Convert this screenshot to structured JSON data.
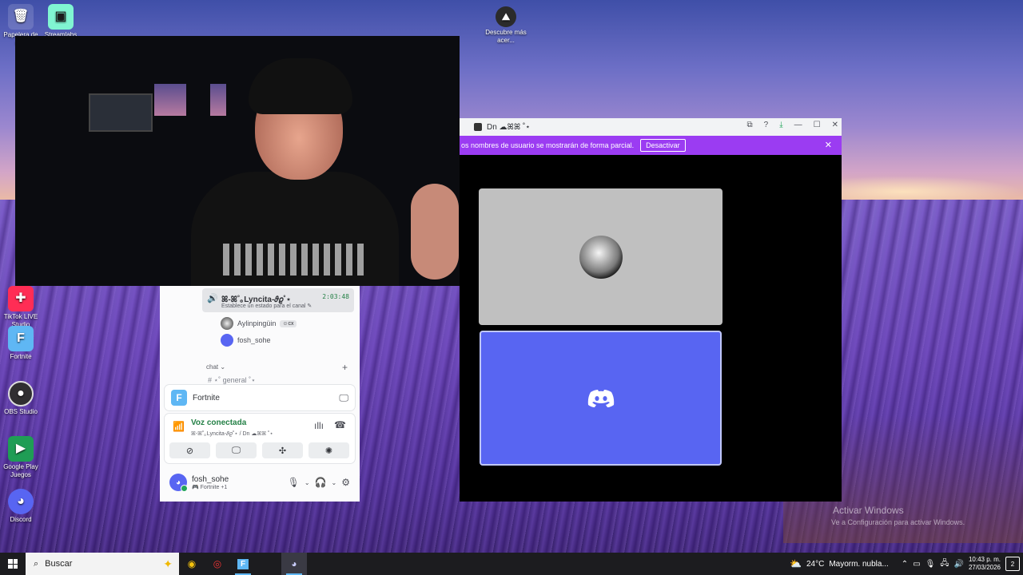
{
  "desktop": {
    "icons": [
      {
        "label": "Papelera de reciclaje",
        "short": "Papelera de re..."
      },
      {
        "label": "Streamlabs",
        "short": "Streamlabs"
      },
      {
        "label": "Descubre más acerca",
        "short": "Descubre más acer..."
      },
      {
        "label": "TikTok LIVE Studio",
        "short": "TikTok LIVE Studio"
      },
      {
        "label": "Fortnite",
        "short": "Fortnite"
      },
      {
        "label": "OBS Studio",
        "short": "OBS Studio"
      },
      {
        "label": "Google Play Juegos",
        "short": "Google Play Juegos"
      },
      {
        "label": "Discord",
        "short": "Discord"
      }
    ],
    "watermark": {
      "title": "Activar Windows",
      "subtitle": "Ve a Configuración para activar Windows."
    }
  },
  "discord_panel": {
    "voice_user": {
      "name": "ꕤ-ꕤ˚｡Lyncita-𝜗𝜚˚⋆",
      "duration": "2:03:48",
      "status_hint": "Establece un estado para el canal ✎"
    },
    "members": [
      {
        "name": "Aylinpingüin",
        "badge": "☺cx"
      },
      {
        "name": "fosh_sohe",
        "badge": ""
      }
    ],
    "category": "chat ⌄",
    "category_add": "+",
    "channel_preview": "#  ⋆˚ general ˚⋆",
    "activity": {
      "logo": "F",
      "name": "Fortnite",
      "action_icon": "screen-share"
    },
    "voice": {
      "title": "Voz conectada",
      "subtitle": "ꕤ-ꕤ˚｡Lyncita-𝜗𝜚˚⋆ / Dn ☁ꕤꕤ ˚⋆"
    },
    "user": {
      "name": "fosh_sohe",
      "status": "🎮 Fortnite +1"
    }
  },
  "discord_window": {
    "title": "Dn ☁ꕤꕤ ˚⋆",
    "notice_text": "os nombres de usuario se mostrarán de forma parcial.",
    "notice_button": "Desactivar",
    "close_glyph": "✕",
    "minimize_glyph": "—",
    "maximize_glyph": "☐"
  },
  "taskbar": {
    "search_placeholder": "Buscar",
    "weather_temp": "24°C",
    "weather_desc": "Mayorm. nubla...",
    "time": "10:43 p. m.",
    "date": "27/03/2026",
    "notifications": "2"
  },
  "colors": {
    "discord_blurple": "#5865f2",
    "notice_purple": "#9b3cf2",
    "voice_green": "#248046"
  }
}
